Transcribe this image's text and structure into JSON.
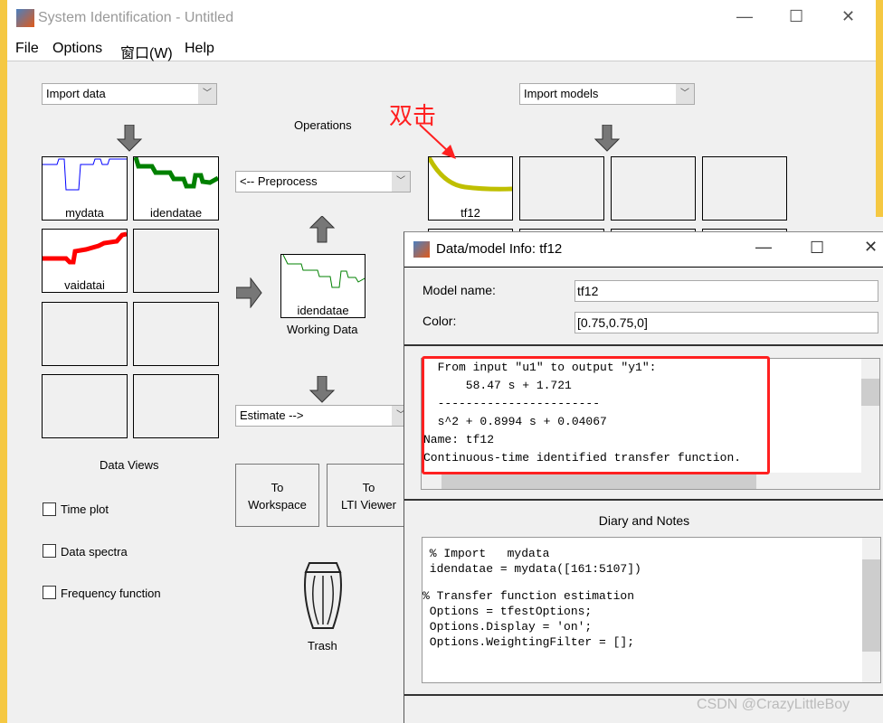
{
  "window": {
    "title": "System Identification - Untitled",
    "minimize": "—",
    "maximize": "☐",
    "close": "✕"
  },
  "menu": [
    "File",
    "Options",
    "窗口(W)",
    "Help"
  ],
  "import_data": {
    "value": "Import data"
  },
  "data_boxes": [
    "mydata",
    "idendatae",
    "vaidatai",
    "",
    "",
    "",
    "",
    ""
  ],
  "operations": {
    "label": "Operations",
    "preprocess": "<-- Preprocess",
    "estimate": "Estimate -->"
  },
  "working_data": {
    "name": "idendatae",
    "label": "Working Data"
  },
  "buttons": {
    "to_workspace": [
      "To",
      "Workspace"
    ],
    "to_lti": [
      "To",
      "LTI Viewer"
    ]
  },
  "data_views": {
    "label": "Data Views",
    "checkboxes": [
      "Time plot",
      "Data spectra",
      "Frequency function"
    ]
  },
  "trash": "Trash",
  "import_models": {
    "value": "Import models"
  },
  "model_boxes": [
    "tf12",
    "",
    "",
    ""
  ],
  "annotation": {
    "text": "双击",
    "color": "#ff2020"
  },
  "colors": {
    "mydata": "#0000ff",
    "idendatae": "#008000",
    "vaidatai": "#ff0000",
    "tf12": "#bfbf00"
  },
  "dialog": {
    "title": "Data/model Info: tf12",
    "model_name_label": "Model name:",
    "model_name": "tf12",
    "color_label": "Color:",
    "color": "[0.75,0.75,0]",
    "info_lines": [
      "  From input \"u1\" to output \"y1\":",
      "      58.47 s + 1.721",
      "  -----------------------",
      "  s^2 + 0.8994 s + 0.04067",
      "Name: tf12",
      "Continuous-time identified transfer function."
    ],
    "diary_title": "Diary and Notes",
    "diary_lines": [
      "",
      " % Import   mydata",
      " idendatae = mydata([161:5107])",
      "",
      "% Transfer function estimation",
      " Options = tfestOptions;",
      " Options.Display = 'on';",
      " Options.WeightingFilter = [];"
    ]
  },
  "watermark": "CSDN @CrazyLittleBoy"
}
